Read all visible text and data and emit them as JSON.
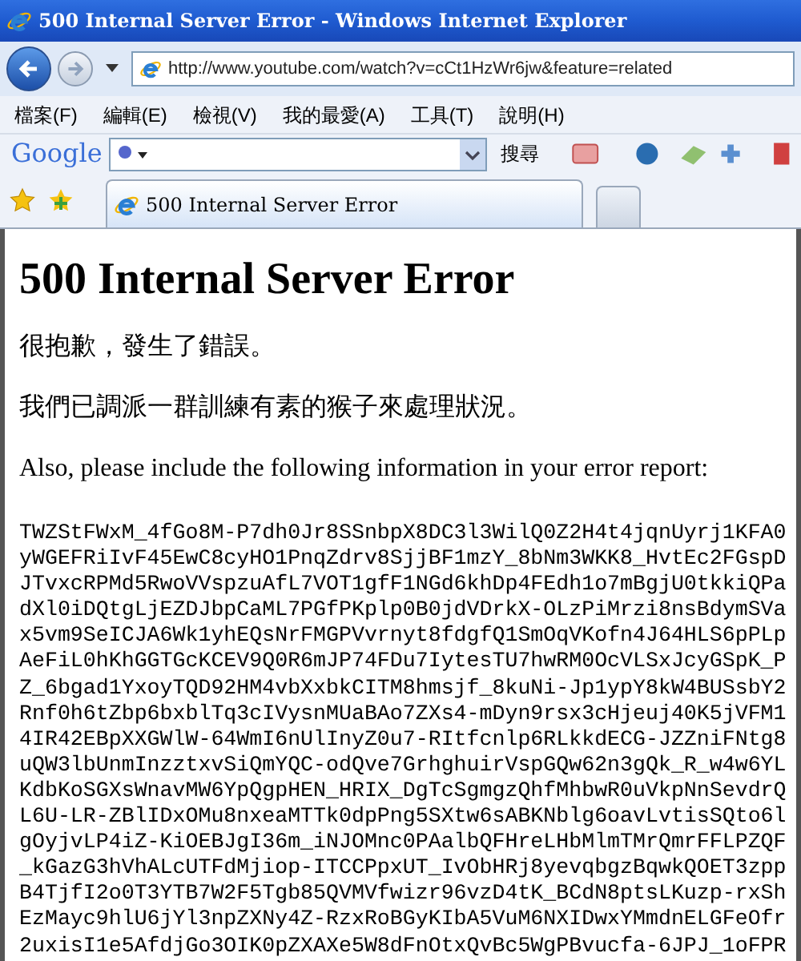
{
  "window": {
    "title": "500 Internal Server Error - Windows Internet Explorer"
  },
  "address_bar": {
    "url": "http://www.youtube.com/watch?v=cCt1HzWr6jw&feature=related"
  },
  "menu": [
    "檔案(F)",
    "編輯(E)",
    "檢視(V)",
    "我的最愛(A)",
    "工具(T)",
    "說明(H)"
  ],
  "google_toolbar": {
    "logo": "Google",
    "search_button": "搜尋"
  },
  "tabs": [
    {
      "title": "500 Internal Server Error",
      "selected": true
    }
  ],
  "page": {
    "heading": "500 Internal Server Error",
    "paragraphs": [
      "很抱歉，發生了錯誤。",
      "我們已調派一群訓練有素的猴子來處理狀況。",
      "Also, please include the following information in your error report:"
    ],
    "code_lines": [
      "TWZStFWxM_4fGo8M-P7dh0Jr8SSnbpX8DC3l3WilQ0Z2H4t4jqnUyrj1KFA0",
      "yWGEFRiIvF45EwC8cyHO1PnqZdrv8SjjBF1mzY_8bNm3WKK8_HvtEc2FGspD",
      "JTvxcRPMd5RwoVVspzuAfL7VOT1gfF1NGd6khDp4FEdh1o7mBgjU0tkkiQPa",
      "dXl0iDQtgLjEZDJbpCaML7PGfPKplp0B0jdVDrkX-OLzPiMrzi8nsBdymSVa",
      "x5vm9SeICJA6Wk1yhEQsNrFMGPVvrnyt8fdgfQ1SmOqVKofn4J64HLS6pPLp",
      "AeFiL0hKhGGTGcKCEV9Q0R6mJP74FDu7IytesTU7hwRM0OcVLSxJcyGSpK_P",
      "Z_6bgad1YxoyTQD92HM4vbXxbkCITM8hmsjf_8kuNi-Jp1ypY8kW4BUSsbY2",
      "Rnf0h6tZbp6bxblTq3cIVysnMUaBAo7ZXs4-mDyn9rsx3cHjeuj40K5jVFM1",
      "4IR42EBpXXGWlW-64WmI6nUlInyZ0u7-RItfcnlp6RLkkdECG-JZZniFNtg8",
      "uQW3lbUnmInzztxvSiQmYQC-odQve7GrhghuirVspGQw62n3gQk_R_w4w6YL",
      "KdbKoSGXsWnavMW6YpQgpHEN_HRIX_DgTcSgmgzQhfMhbwR0uVkpNnSevdrQ",
      "L6U-LR-ZBlIDxOMu8nxeaMTTk0dpPng5SXtw6sABKNblg6oavLvtisSQto6l",
      "gOyjvLP4iZ-KiOEBJgI36m_iNJOMnc0PAalbQFHreLHbMlmTMrQmrFFLPZQF",
      "_kGazG3hVhALcUTFdMjiop-ITCCPpxUT_IvObHRj8yevqbgzBqwkQOET3zpp",
      "B4TjfI2o0T3YTB7W2F5Tgb85QVMVfwizr96vzD4tK_BCdN8ptsLKuzp-rxSh",
      "EzMayc9hlU6jYl3npZXNy4Z-RzxRoBGyKIbA5VuM6NXIDwxYMmdnELGFeOfr",
      "2uxisI1e5AfdjGo3OIK0pZXAXe5W8dFnOtxQvBc5WgPBvucfa-6JPJ_1oFPR"
    ]
  }
}
